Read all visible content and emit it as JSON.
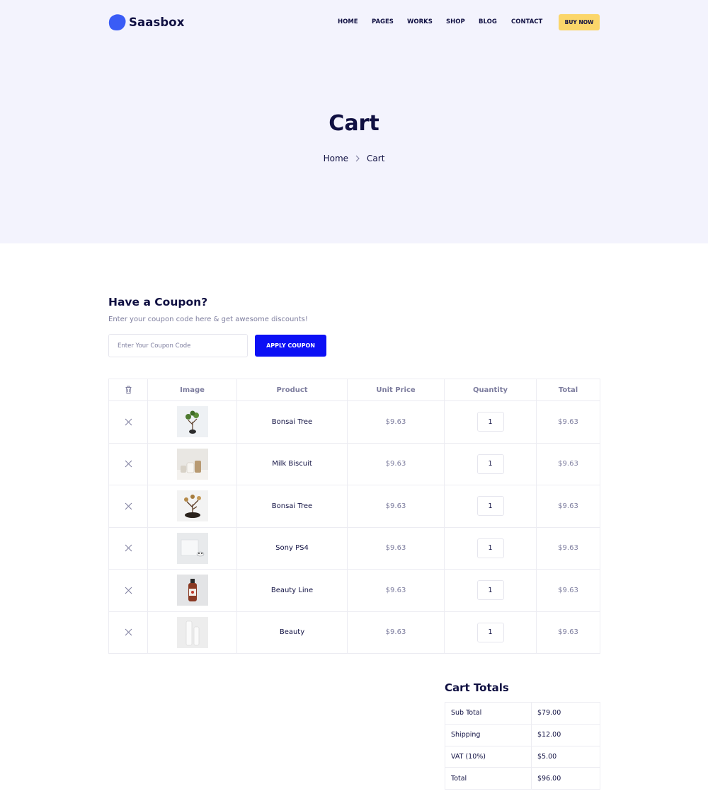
{
  "brand": {
    "name": "Saasbox",
    "color": "#3a5cf6"
  },
  "nav": {
    "items": [
      "HOME",
      "PAGES",
      "WORKS",
      "SHOP",
      "BLOG",
      "CONTACT"
    ],
    "cta": "BUY NOW"
  },
  "hero": {
    "title": "Cart",
    "breadcrumb": [
      "Home",
      "Cart"
    ]
  },
  "coupon": {
    "title": "Have a Coupon?",
    "description": "Enter your coupon code here & get awesome discounts!",
    "placeholder": "Enter Your Coupon Code",
    "button": "APPLY COUPON"
  },
  "cart": {
    "headers": {
      "remove_icon": "trash-icon",
      "image": "Image",
      "product": "Product",
      "unit_price": "Unit Price",
      "quantity": "Quantity",
      "total": "Total"
    },
    "items": [
      {
        "product": "Bonsai Tree",
        "unit_price": "$9.63",
        "quantity": "1",
        "total": "$9.63"
      },
      {
        "product": "Milk Biscuit",
        "unit_price": "$9.63",
        "quantity": "1",
        "total": "$9.63"
      },
      {
        "product": "Bonsai Tree",
        "unit_price": "$9.63",
        "quantity": "1",
        "total": "$9.63"
      },
      {
        "product": "Sony PS4",
        "unit_price": "$9.63",
        "quantity": "1",
        "total": "$9.63"
      },
      {
        "product": "Beauty Line",
        "unit_price": "$9.63",
        "quantity": "1",
        "total": "$9.63"
      },
      {
        "product": "Beauty",
        "unit_price": "$9.63",
        "quantity": "1",
        "total": "$9.63"
      }
    ]
  },
  "totals": {
    "title": "Cart Totals",
    "rows": [
      {
        "label": "Sub Total",
        "value": "$79.00"
      },
      {
        "label": "Shipping",
        "value": "$12.00"
      },
      {
        "label": "VAT (10%)",
        "value": "$5.00"
      },
      {
        "label": "Total",
        "value": "$96.00"
      }
    ]
  },
  "colors": {
    "accent": "#0c10f5",
    "cta": "#fbd66a",
    "hero_bg": "#f3f3fd",
    "text": "#101042",
    "muted": "#7d7d9e"
  }
}
